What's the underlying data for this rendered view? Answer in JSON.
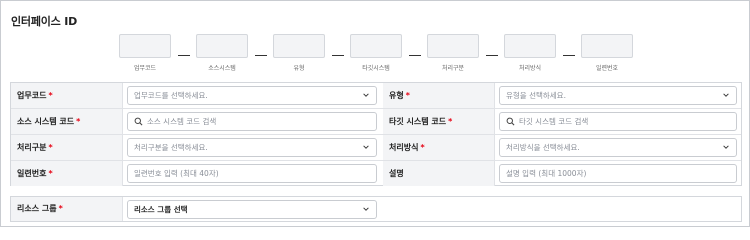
{
  "title": "인터페이스 ID",
  "id_segments": [
    {
      "label": "업무코드"
    },
    {
      "label": "소스시스템"
    },
    {
      "label": "유형"
    },
    {
      "label": "타깃시스템"
    },
    {
      "label": "처리구분"
    },
    {
      "label": "처리방식"
    },
    {
      "label": "일련번호"
    }
  ],
  "form": {
    "business_code": {
      "label": "업무코드",
      "required": "*",
      "placeholder": "업무코드를 선택하세요."
    },
    "type": {
      "label": "유형",
      "required": "*",
      "placeholder": "유형을 선택하세요."
    },
    "source_system_code": {
      "label": "소스 시스템 코드",
      "required": "*",
      "placeholder": "소스 시스템 코드 검색"
    },
    "target_system_code": {
      "label": "타깃 시스템 코드",
      "required": "*",
      "placeholder": "타깃 시스템 코드 검색"
    },
    "process_category": {
      "label": "처리구분",
      "required": "*",
      "placeholder": "처리구분을 선택하세요."
    },
    "process_method": {
      "label": "처리방식",
      "required": "*",
      "placeholder": "처리방식을 선택하세요."
    },
    "serial_number": {
      "label": "일련번호",
      "required": "*",
      "placeholder": "일련번호 입력 (최대 40자)"
    },
    "description": {
      "label": "설명",
      "placeholder": "설명 입력 (최대 1000자)"
    },
    "resource_group": {
      "label": "리소스 그룹",
      "required": "*",
      "value": "리소스 그룹 선택"
    }
  },
  "colors": {
    "required": "#e60012",
    "label_bg": "#f3f4f6",
    "border": "#c9ccd1"
  },
  "icons": {
    "dropdown": "chevron-down-icon",
    "search": "search-icon"
  }
}
